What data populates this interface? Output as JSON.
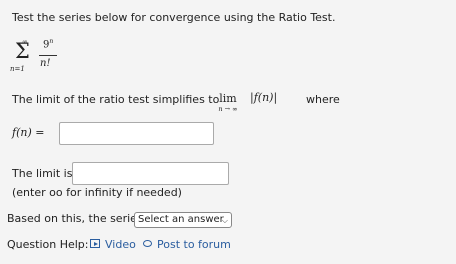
{
  "question": "Test the series below for convergence using the Ratio Test.",
  "series": {
    "sum_top": "∞",
    "sum_bottom": "n=1",
    "numerator": "9",
    "numerator_exp": "n",
    "denominator": "n!"
  },
  "ratio": {
    "text": "The limit of the ratio test simplifies to",
    "lim": "lim",
    "lim_sub": "n → ∞",
    "abs_expr": "|f(n)|",
    "where": "where"
  },
  "fn_label": "f(n) =",
  "fn_value": "",
  "limit": {
    "label": "The limit is:",
    "value": "",
    "hint": "(enter oo for infinity if needed)"
  },
  "conclusion": {
    "text": "Based on this, the series",
    "select_value": "Select an answer"
  },
  "help": {
    "label": "Question Help:",
    "video": "Video",
    "forum": "Post to forum"
  }
}
